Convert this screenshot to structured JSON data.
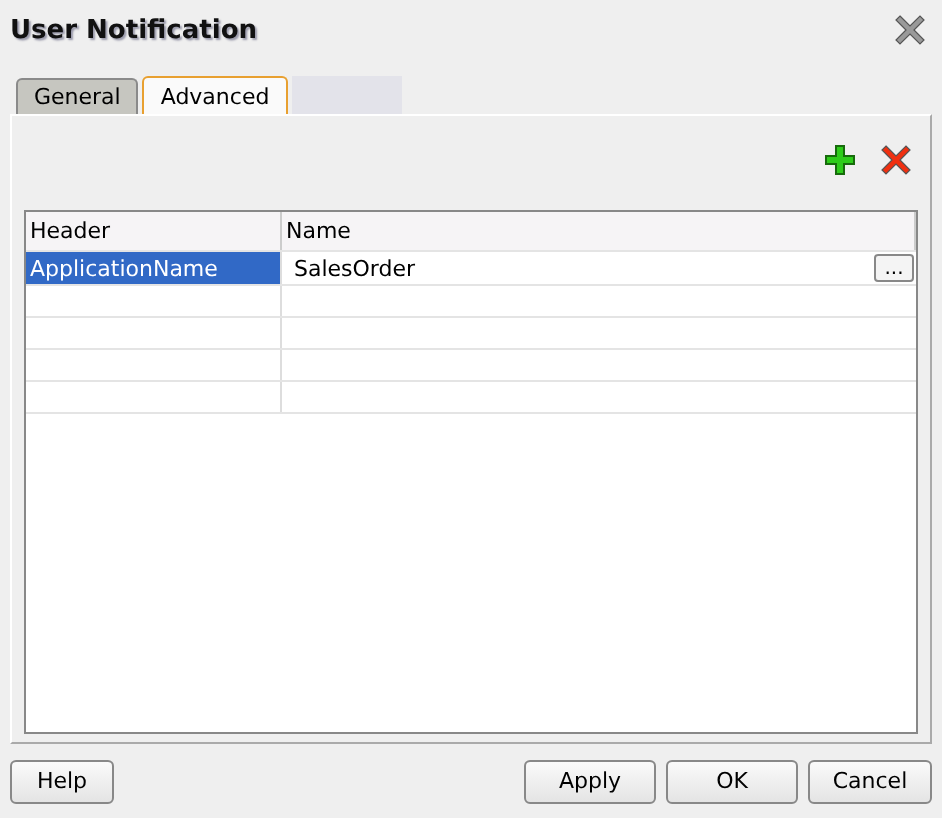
{
  "window": {
    "title": "User Notification"
  },
  "tabs": [
    {
      "label": "General",
      "selected": false
    },
    {
      "label": "Advanced",
      "selected": true
    }
  ],
  "table": {
    "columns": [
      "Header",
      "Name"
    ],
    "rows": [
      {
        "cells": [
          "ApplicationName",
          "SalesOrder"
        ],
        "selected": true,
        "browse_button": "..."
      }
    ]
  },
  "buttons": [
    {
      "label": "Help",
      "kind": "left"
    },
    {
      "label": "Apply",
      "kind": "right"
    },
    {
      "label": "OK",
      "kind": "right"
    },
    {
      "label": "Cancel",
      "kind": "right"
    }
  ]
}
